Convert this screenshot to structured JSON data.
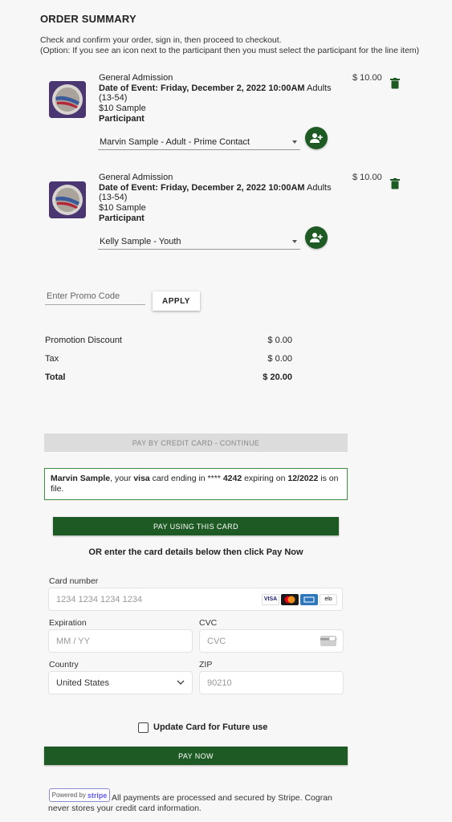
{
  "header": {
    "title": "ORDER SUMMARY",
    "intro_line1": "Check and confirm your order, sign in, then proceed to checkout.",
    "intro_line2": "(Option: If you see an icon next to the participant then you must select the participant for the line item)"
  },
  "items": [
    {
      "name": "General Admission",
      "date_label": "Date of Event: Friday, December 2, 2022 10:00AM",
      "ticket_type": "Adults (13-54)",
      "sample": "$10 Sample",
      "participant_label": "Participant",
      "participant_value": "Marvin Sample - Adult - Prime Contact",
      "price": "$ 10.00"
    },
    {
      "name": "General Admission",
      "date_label": "Date of Event: Friday, December 2, 2022 10:00AM",
      "ticket_type": "Adults (13-54)",
      "sample": "$10 Sample",
      "participant_label": "Participant",
      "participant_value": "Kelly Sample - Youth",
      "price": "$ 10.00"
    }
  ],
  "promo": {
    "placeholder": "Enter Promo Code",
    "apply_label": "APPLY"
  },
  "summary": {
    "discount_label": "Promotion Discount",
    "discount_value": "$ 0.00",
    "tax_label": "Tax",
    "tax_value": "$ 0.00",
    "total_label": "Total",
    "total_value": "$ 20.00"
  },
  "pay_credit_label": "PAY BY CREDIT CARD - CONTINUE",
  "card_on_file": {
    "name": "Marvin Sample",
    "text1": ", your ",
    "brand": "visa",
    "text2": " card ending in **** ",
    "last4": "4242",
    "text3": " expiring on ",
    "expiry": "12/2022",
    "text4": " is on file."
  },
  "pay_using_card_label": "PAY USING THIS CARD",
  "or_text": "OR enter the card details below then click Pay Now",
  "card_form": {
    "card_number_label": "Card number",
    "card_number_placeholder": "1234 1234 1234 1234",
    "brands": [
      "VISA",
      "mastercard",
      "amex",
      "elo"
    ],
    "expiration_label": "Expiration",
    "expiration_placeholder": "MM / YY",
    "cvc_label": "CVC",
    "cvc_placeholder": "CVC",
    "country_label": "Country",
    "country_value": "United States",
    "zip_label": "ZIP",
    "zip_value": "90210"
  },
  "update_card_label": "Update Card for Future use",
  "pay_now_label": "PAY NOW",
  "footer": {
    "powered_by": "Powered by",
    "stripe": "stripe",
    "secure_text": "All payments are processed and secured by Stripe. Cogran never stores your credit card information."
  },
  "colors": {
    "primary_green": "#1e5b24",
    "border_green": "#3c8e3f",
    "disabled_grey": "#dcdcdc"
  }
}
